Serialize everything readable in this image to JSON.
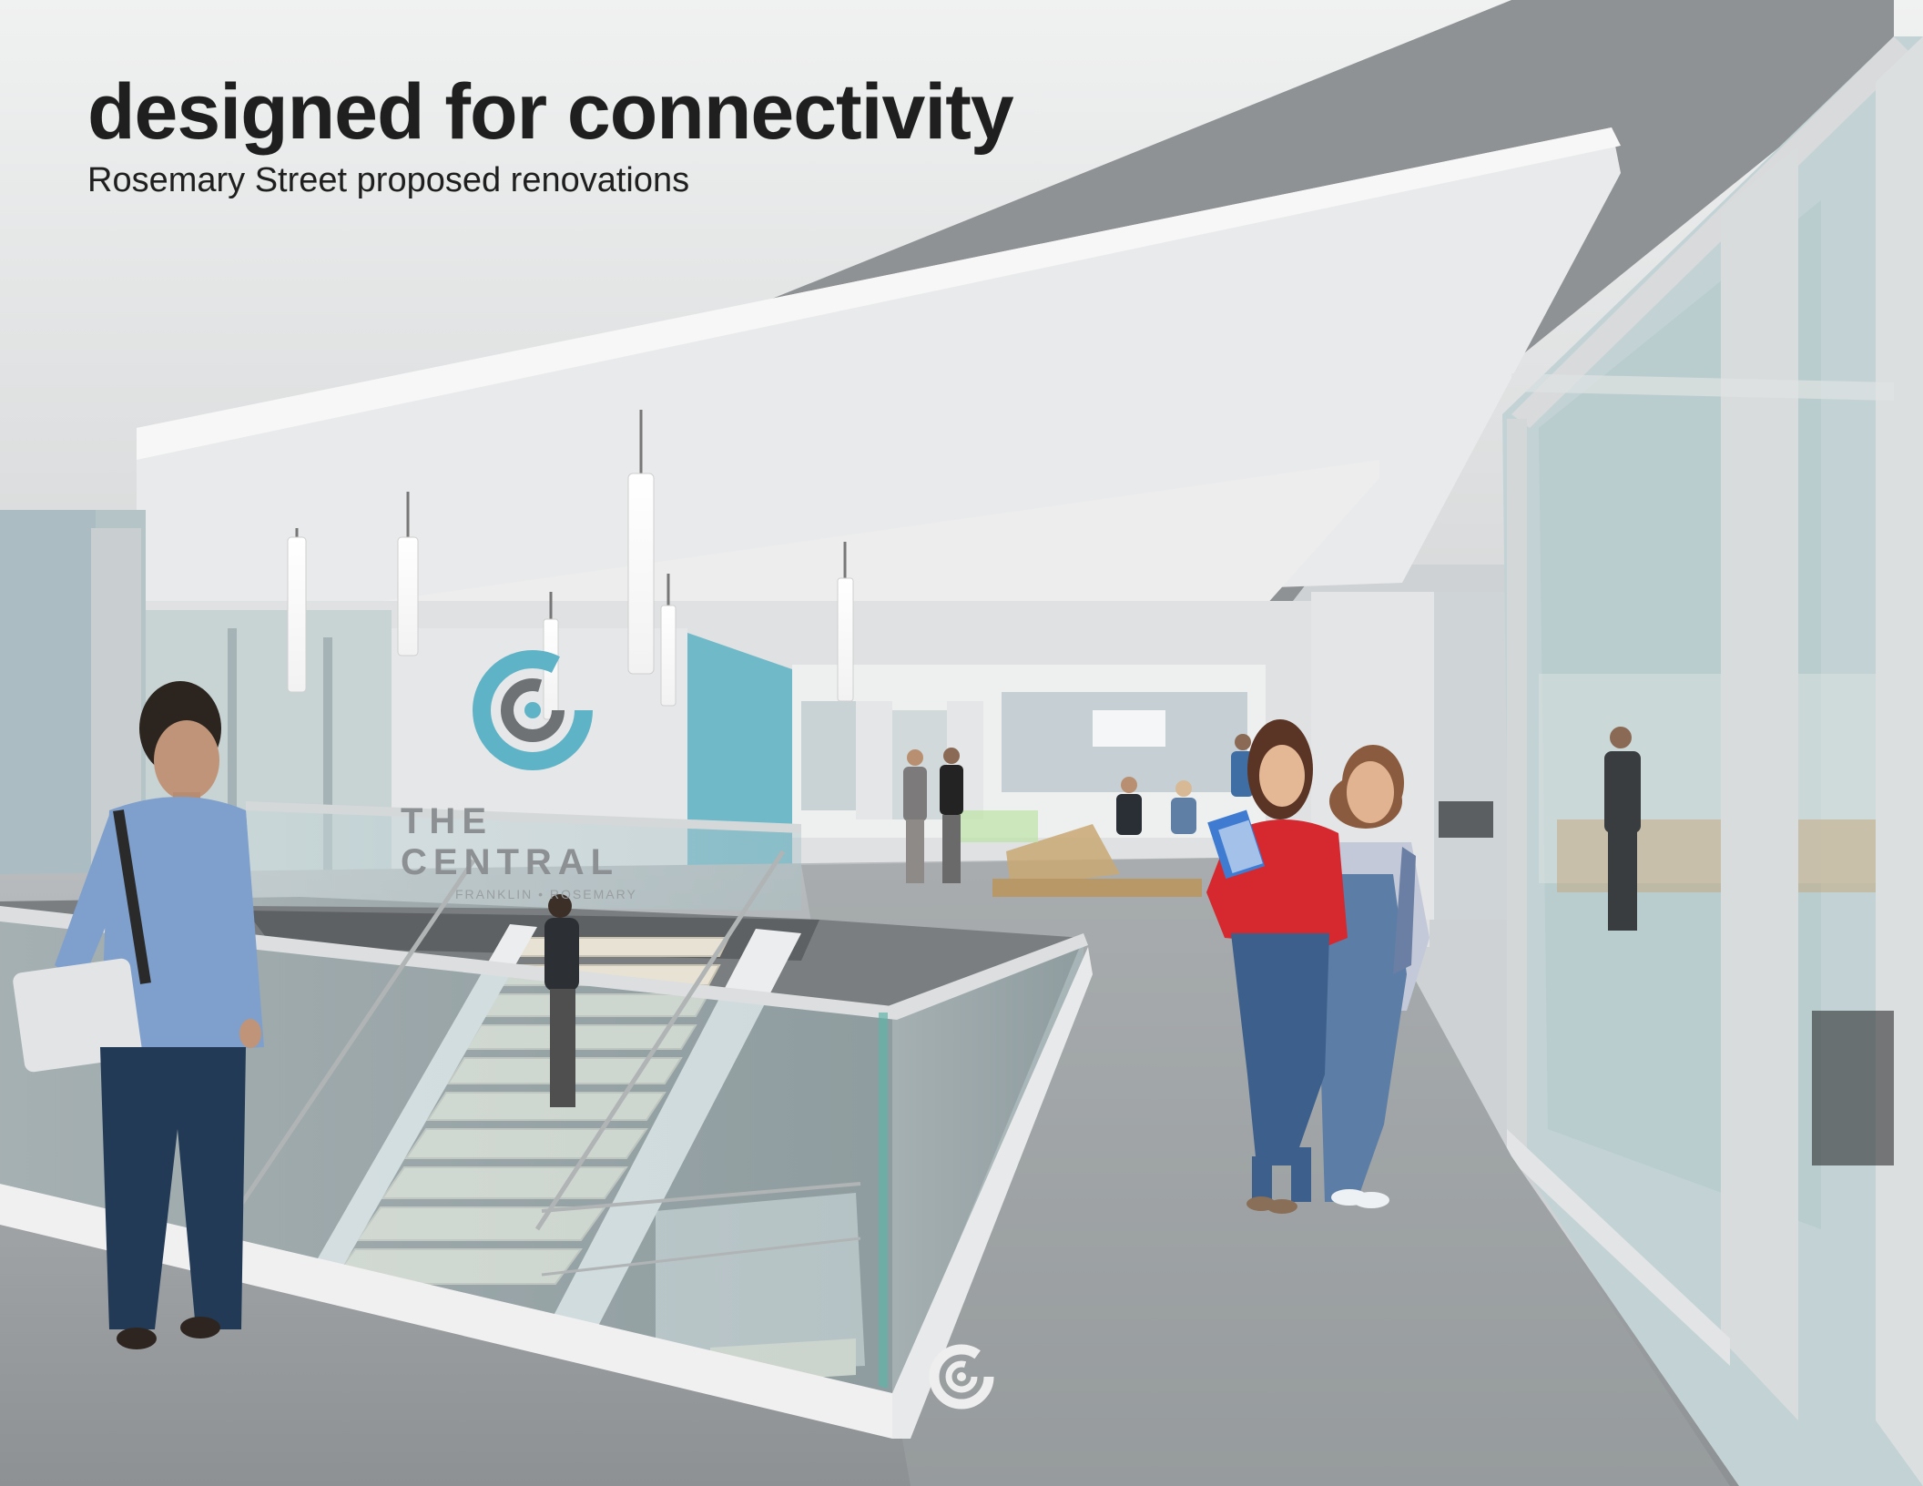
{
  "header": {
    "title": "designed for connectivity",
    "subtitle": "Rosemary Street proposed renovations"
  },
  "wall_sign": {
    "name": "THE CENTRAL",
    "tagline": "FRANKLIN • ROSEMARY"
  },
  "colors": {
    "ceiling": "#e6e7e8",
    "soffit": "#8e9092",
    "floor": "#9fa3a5",
    "wall": "#dfe1e2",
    "accent_blue": "#6fb9c9",
    "logo_teal": "#5fb3c6",
    "logo_gray": "#6e7275",
    "glass": "#bcd3d6",
    "title_text": "#1f1f1f"
  },
  "icons": [
    "central-logo-icon",
    "bottom-logo-icon"
  ]
}
